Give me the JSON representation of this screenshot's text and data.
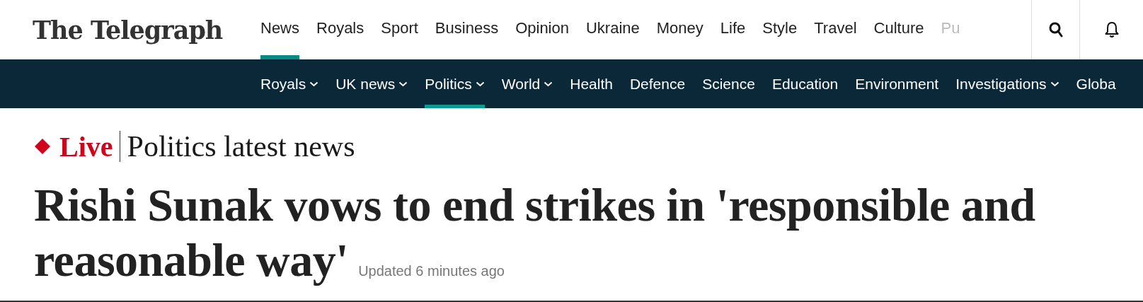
{
  "logo": "The Telegraph",
  "main_nav": [
    {
      "label": "News",
      "selected": true
    },
    {
      "label": "Royals",
      "selected": false
    },
    {
      "label": "Sport",
      "selected": false
    },
    {
      "label": "Business",
      "selected": false
    },
    {
      "label": "Opinion",
      "selected": false
    },
    {
      "label": "Ukraine",
      "selected": false
    },
    {
      "label": "Money",
      "selected": false
    },
    {
      "label": "Life",
      "selected": false
    },
    {
      "label": "Style",
      "selected": false
    },
    {
      "label": "Travel",
      "selected": false
    },
    {
      "label": "Culture",
      "selected": false
    },
    {
      "label": "Pu",
      "selected": false
    }
  ],
  "sub_nav": [
    {
      "label": "Royals",
      "selected": false,
      "dropdown": true
    },
    {
      "label": "UK news",
      "selected": false,
      "dropdown": true
    },
    {
      "label": "Politics",
      "selected": true,
      "dropdown": true
    },
    {
      "label": "World",
      "selected": false,
      "dropdown": true
    },
    {
      "label": "Health",
      "selected": false,
      "dropdown": false
    },
    {
      "label": "Defence",
      "selected": false,
      "dropdown": false
    },
    {
      "label": "Science",
      "selected": false,
      "dropdown": false
    },
    {
      "label": "Education",
      "selected": false,
      "dropdown": false
    },
    {
      "label": "Environment",
      "selected": false,
      "dropdown": false
    },
    {
      "label": "Investigations",
      "selected": false,
      "dropdown": true
    },
    {
      "label": "Globa",
      "selected": false,
      "dropdown": false
    }
  ],
  "live_label": "Live",
  "section_title": "Politics latest news",
  "headline_lines": [
    "Rishi Sunak vows to end strikes in 'responsible and",
    "reasonable way'"
  ],
  "updated": "Updated 6 minutes ago"
}
